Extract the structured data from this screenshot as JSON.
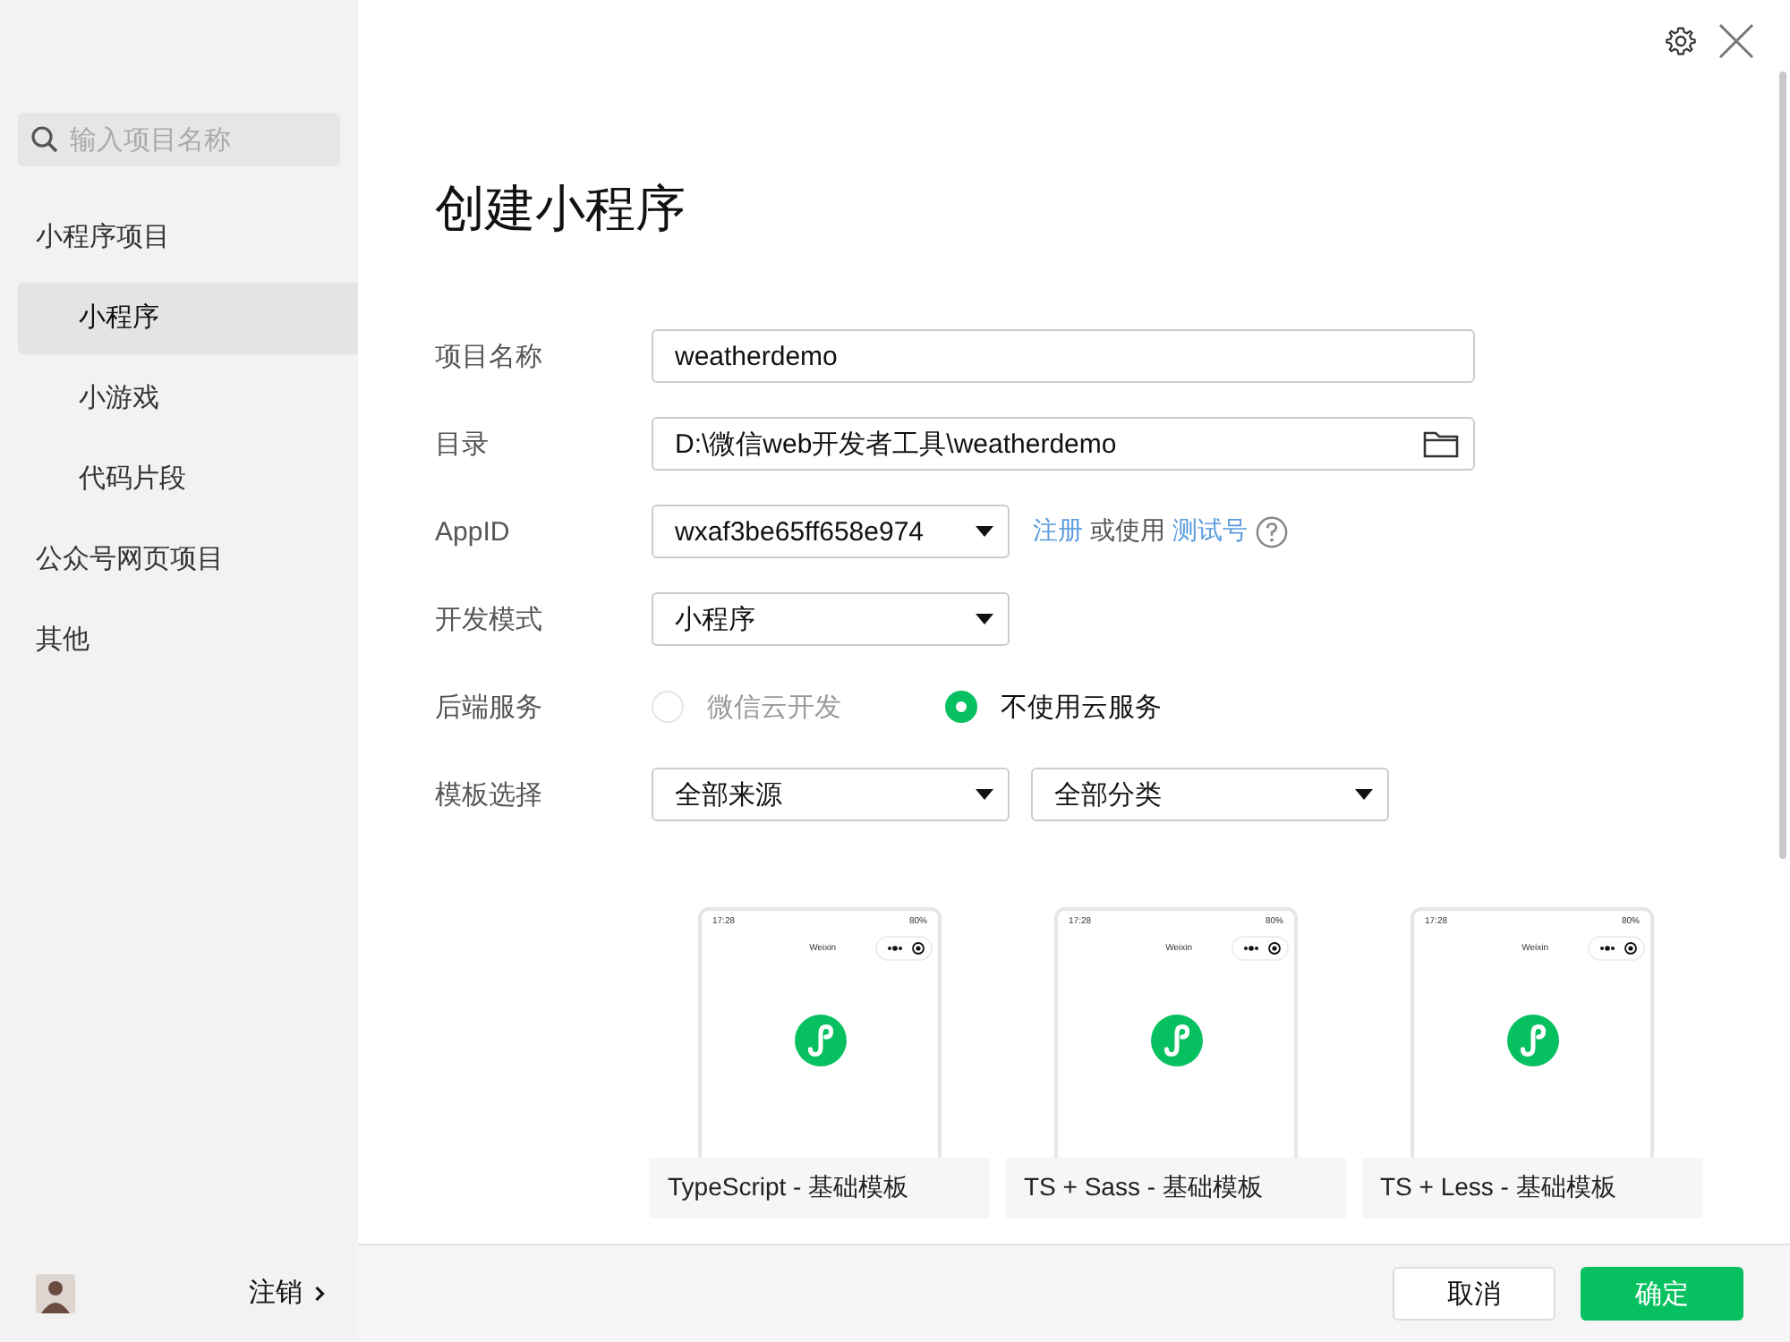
{
  "sidebar": {
    "search": {
      "placeholder": "输入项目名称"
    },
    "sections": [
      {
        "label": "小程序项目",
        "selected": false,
        "children": [
          {
            "label": "小程序",
            "selected": true
          },
          {
            "label": "小游戏",
            "selected": false
          },
          {
            "label": "代码片段",
            "selected": false
          }
        ]
      },
      {
        "label": "公众号网页项目",
        "selected": false
      },
      {
        "label": "其他",
        "selected": false
      }
    ],
    "user": {
      "logout": "注销"
    }
  },
  "title": "创建小程序",
  "form": [
    {
      "kind": "text",
      "label": "项目名称",
      "value": "weatherdemo"
    },
    {
      "kind": "folder",
      "label": "目录",
      "value": "D:\\微信web开发者工具\\weatherdemo"
    },
    {
      "kind": "appid",
      "label": "AppID",
      "value": "wxaf3be65ff658e974",
      "hint": [
        {
          "kind": "link",
          "text": "注册"
        },
        {
          "kind": "text",
          "text": "或使用"
        },
        {
          "kind": "link",
          "text": "测试号"
        }
      ]
    },
    {
      "kind": "select",
      "label": "开发模式",
      "value": "小程序"
    },
    {
      "kind": "radio",
      "label": "后端服务",
      "options": [
        {
          "label": "微信云开发",
          "selected": false,
          "disabled": true
        },
        {
          "label": "不使用云服务",
          "selected": true,
          "disabled": false
        }
      ]
    },
    {
      "kind": "selects",
      "label": "模板选择",
      "values": [
        "全部来源",
        "全部分类"
      ]
    }
  ],
  "templates": [
    {
      "time": "17:28",
      "battery": "80%",
      "app_title": "Weixin",
      "title": "TypeScript - 基础模板"
    },
    {
      "time": "17:28",
      "battery": "80%",
      "app_title": "Weixin",
      "title": "TS + Sass - 基础模板"
    },
    {
      "time": "17:28",
      "battery": "80%",
      "app_title": "Weixin",
      "title": "TS + Less - 基础模板"
    }
  ],
  "buttons": [
    {
      "kind": "secondary",
      "label": "取消"
    },
    {
      "kind": "primary",
      "label": "确定"
    }
  ]
}
